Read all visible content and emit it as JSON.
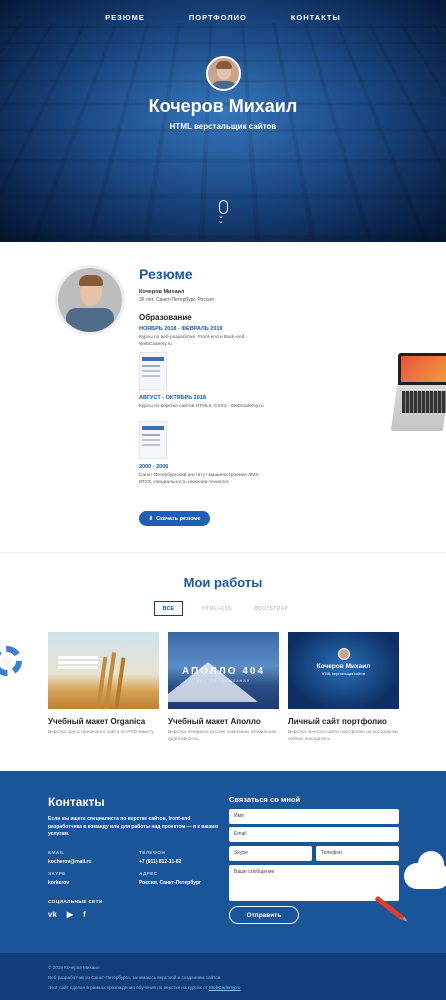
{
  "nav": {
    "items": [
      "РЕЗЮМЕ",
      "ПОРТФОЛИО",
      "КОНТАКТЫ"
    ]
  },
  "hero": {
    "name": "Кочеров Михаил",
    "subtitle": "HTML верстальщик сайтов"
  },
  "resume": {
    "title": "Резюме",
    "person_name": "Кочеров Михаил",
    "person_info": "36 лет, Санкт-Петербург, Россия",
    "education_title": "Образование",
    "education": [
      {
        "date": "НОЯБРЬ 2018 - ФЕВРАЛЬ 2019",
        "desc": "Курсы по веб-разработке. Front-end и Back-end - WebCademy.ru"
      },
      {
        "date": "АВГУСТ - ОКТЯБРЬ 2018",
        "desc": "Курсы по верстке сайтов HTML5, CSS3 - WebCademy.ru"
      },
      {
        "date": "2000 - 2006",
        "desc": "Санкт-Петербургский институт машиностроения ЛМЗ-ВТУЗ, специальность инженер-технолог."
      }
    ],
    "download_label": "Скачать резюме"
  },
  "works": {
    "title": "Мои работы",
    "filters": [
      "ВСЕ",
      "HTML+CSS",
      "BOOTSTRAP"
    ],
    "cards": [
      {
        "title": "Учебный макет Organica",
        "desc": "Верстка одностраничного сайта по PSD макету."
      },
      {
        "title": "Учебный макет Аполло",
        "desc": "Верстка лендинга хостинг компании. Мобильная адаптивность.",
        "thumb_big": "АПОЛЛО 404",
        "thumb_small": "ХОСТИНГ КОМПАНИЯ"
      },
      {
        "title": "Личный сайт портфолио",
        "desc": "Верстка личного сайта портфолио на котором вы сейчас находитесь.",
        "thumb_name": "Кочеров Михаил",
        "thumb_sub": "HTML верстальщик сайтов"
      }
    ]
  },
  "contacts": {
    "title": "Контакты",
    "lead": "Если вы ищете специалиста по верстке сайтов, front-end разработчика в команду или для работы над проектом — я к вашим услугам.",
    "email_label": "EMAIL",
    "email": "kocherov@mail.ru",
    "phone_label": "ТЕЛЕФОН",
    "phone": "+7 (911) 812-11-82",
    "skype_label": "SKYPE",
    "skype": "korkerov",
    "address_label": "АДРЕС",
    "address": "Россия, Санкт-Петербург",
    "social_label": "СОЦИАЛЬНЫЕ СЕТИ",
    "social_icons": [
      "vk-icon",
      "youtube-icon",
      "facebook-icon"
    ],
    "form_title": "Связаться со мной",
    "placeholders": {
      "name": "Имя",
      "email": "Email",
      "skype": "Skype",
      "phone": "Телефон",
      "message": "Ваше сообщение"
    },
    "send_label": "Отправить"
  },
  "footer": {
    "copyright": "© 2018 Кочеров Михаил",
    "line2": "Веб-разработчик из Санкт-Петербурга, занимаюсь версткой и созданием сайтов.",
    "line3": "Этот сайт сделан в рамках прохождения обучения по верстке на курсах от",
    "link": "WebCademy.ru"
  },
  "colors": {
    "accent": "#1b57a5",
    "contacts_bg": "#1a5499",
    "footer_bg": "#123f7a"
  }
}
